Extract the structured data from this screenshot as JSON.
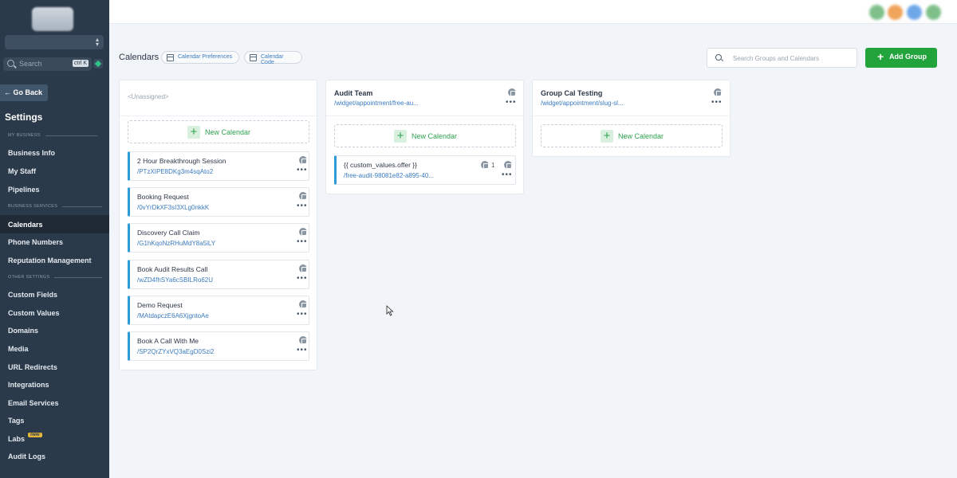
{
  "sidebar": {
    "search_placeholder": "Search",
    "search_shortcut": "ctrl K",
    "go_back": "Go Back",
    "settings_title": "Settings",
    "section_my_business": "MY BUSINESS",
    "section_business_services": "BUSINESS SERVICES",
    "section_other_settings": "OTHER SETTINGS",
    "items": {
      "business_info": "Business Info",
      "my_staff": "My Staff",
      "pipelines": "Pipelines",
      "calendars": "Calendars",
      "phone_numbers": "Phone Numbers",
      "reputation_management": "Reputation Management",
      "custom_fields": "Custom Fields",
      "custom_values": "Custom Values",
      "domains": "Domains",
      "media": "Media",
      "url_redirects": "URL Redirects",
      "integrations": "Integrations",
      "email_services": "Email Services",
      "tags": "Tags",
      "labs": "Labs",
      "labs_badge": "new",
      "audit_logs": "Audit Logs"
    }
  },
  "header": {
    "title": "Calendars",
    "calendar_preferences": "Calendar Preferences",
    "calendar_code": "Calendar Code",
    "search_placeholder": "Search Groups and Calendars",
    "add_group": "Add Group"
  },
  "new_calendar_label": "New Calendar",
  "columns": {
    "unassigned": {
      "title": "<Unassigned>",
      "cards": [
        {
          "name": "2 Hour Breakthrough Session",
          "link": "/PTzXIPE8DKg3m4sqAto2"
        },
        {
          "name": "Booking Request",
          "link": "/0vYrDkXF3sI3XLg0nkkK"
        },
        {
          "name": "Discovery Call Claim",
          "link": "/G1hKqoNzRHuMdY8a5iLY"
        },
        {
          "name": "Book Audit Results Call",
          "link": "/wZD4fhSYa6cSBILRo62U"
        },
        {
          "name": "Demo Request",
          "link": "/MAtdapczE6A6XjgntoAe"
        },
        {
          "name": "Book A Call With Me",
          "link": "/SP2QrZYxVQ3aEgD0Szi2"
        }
      ]
    },
    "audit_team": {
      "title": "Audit Team",
      "link": "/widget/appointment/free-au...",
      "cards": [
        {
          "name": "{{ custom_values.offer }}",
          "link": "/free-audit-98081e82-a895-40...",
          "count": "1"
        }
      ]
    },
    "group_cal": {
      "title": "Group Cal Testing",
      "link": "/widget/appointment/slug-sl..."
    }
  },
  "colors": {
    "sidebar_bg": "#2b3a4a",
    "accent_green": "#23a33c",
    "link_blue": "#3b7bbf",
    "card_border": "#2a9bd5",
    "avatar_colors": [
      "#7fc08a",
      "#f0a35a",
      "#6fa8e8",
      "#7fc08a"
    ]
  }
}
